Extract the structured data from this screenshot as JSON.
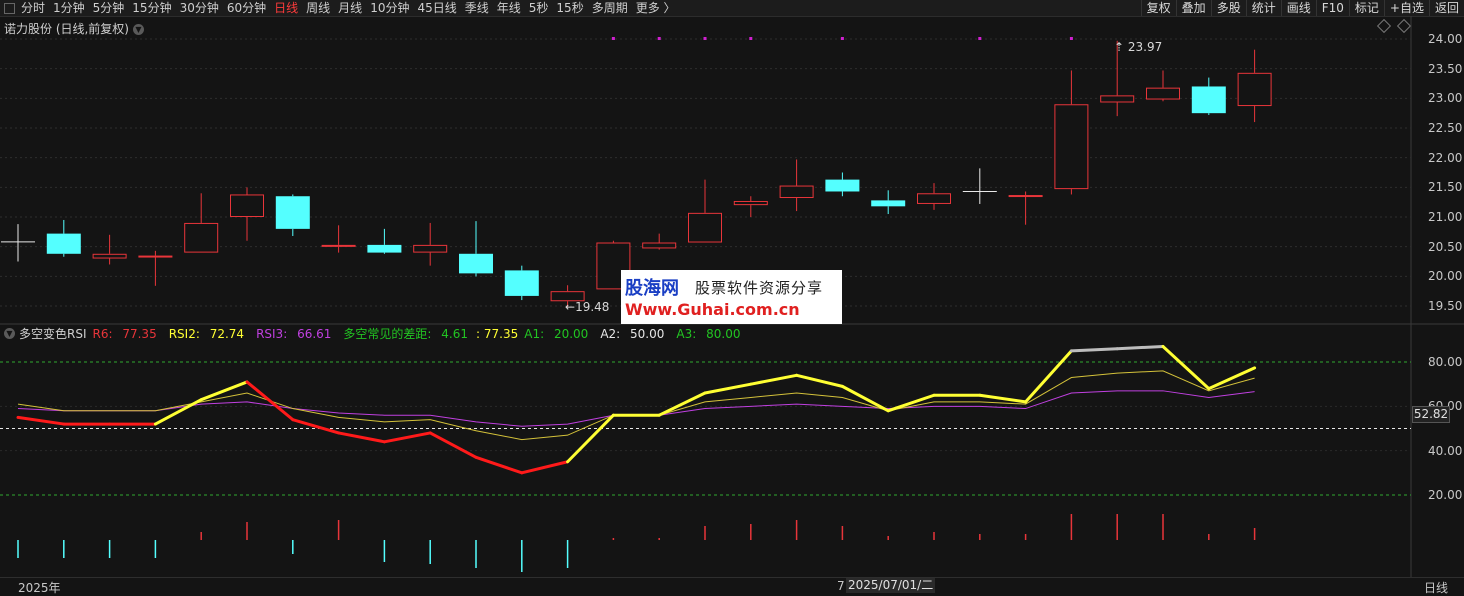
{
  "toolbar": {
    "periods": [
      "分时",
      "1分钟",
      "5分钟",
      "15分钟",
      "30分钟",
      "60分钟",
      "日线",
      "周线",
      "月线",
      "10分钟",
      "45日线",
      "季线",
      "年线",
      "5秒",
      "15秒",
      "多周期",
      "更多 〉"
    ],
    "active_period": "日线",
    "buttons": [
      "复权",
      "叠加",
      "多股",
      "统计",
      "画线",
      "F10",
      "标记",
      "+自选",
      "返回"
    ]
  },
  "stock": {
    "title": "诺力股份 (日线,前复权)"
  },
  "price_axis": {
    "ticks": [
      "24.00",
      "23.50",
      "23.00",
      "22.50",
      "22.00",
      "21.50",
      "21.00",
      "20.50",
      "20.00",
      "19.50"
    ]
  },
  "annotations": {
    "high": "23.97",
    "low": "19.48"
  },
  "indicator": {
    "name": "多空变色RSI",
    "r6_label": "R6:",
    "r6": "77.35",
    "rsi2_label": "RSI2:",
    "rsi2": "72.74",
    "rsi3_label": "RSI3:",
    "rsi3": "66.61",
    "gap_label": "多空常见的差距:",
    "gap": "4.61",
    "gap2": ": 77.35",
    "a1_label": "A1:",
    "a1": "20.00",
    "a2_label": "A2:",
    "a2": "50.00",
    "a3_label": "A3:",
    "a3": "80.00",
    "current_value": "52.82",
    "axis_ticks": [
      "80.00",
      "60.00",
      "40.00",
      "20.00"
    ]
  },
  "bottom": {
    "year": "2025年",
    "cursor_prefix": "7",
    "cursor_date": "2025/07/01/二",
    "period": "日线"
  },
  "watermark": {
    "cn_brand": "股海网",
    "cn_slogan": "股票软件资源分享",
    "url": "Www.Guhai.com.cn"
  },
  "colors": {
    "up": "#e8353a",
    "down": "#54ffff",
    "rsi_up": "#ffff33",
    "rsi_down": "#ff1a1a",
    "rsi2": "#d4c23a",
    "rsi3": "#c040e0"
  },
  "chart_data": {
    "type": "candlestick",
    "ylim": [
      19.3,
      24.15
    ],
    "candles": [
      {
        "o": 20.58,
        "c": 20.58,
        "h": 20.88,
        "l": 20.25
      },
      {
        "o": 20.72,
        "c": 20.38,
        "h": 20.95,
        "l": 20.33
      },
      {
        "o": 20.3,
        "c": 20.38,
        "h": 20.7,
        "l": 20.2
      },
      {
        "o": 20.33,
        "c": 20.35,
        "h": 20.43,
        "l": 19.84
      },
      {
        "o": 20.4,
        "c": 20.9,
        "h": 21.4,
        "l": 20.4
      },
      {
        "o": 21.0,
        "c": 21.38,
        "h": 21.5,
        "l": 20.6
      },
      {
        "o": 21.35,
        "c": 20.8,
        "h": 21.38,
        "l": 20.68
      },
      {
        "o": 20.5,
        "c": 20.53,
        "h": 20.86,
        "l": 20.4
      },
      {
        "o": 20.53,
        "c": 20.4,
        "h": 20.8,
        "l": 20.38
      },
      {
        "o": 20.4,
        "c": 20.53,
        "h": 20.9,
        "l": 20.18
      },
      {
        "o": 20.38,
        "c": 20.05,
        "h": 20.93,
        "l": 20.0
      },
      {
        "o": 20.1,
        "c": 19.67,
        "h": 20.18,
        "l": 19.6
      },
      {
        "o": 19.58,
        "c": 19.75,
        "h": 19.85,
        "l": 19.48
      },
      {
        "o": 19.78,
        "c": 20.57,
        "h": 20.6,
        "l": 19.78
      },
      {
        "o": 20.47,
        "c": 20.57,
        "h": 20.72,
        "l": 20.45
      },
      {
        "o": 20.57,
        "c": 21.07,
        "h": 21.63,
        "l": 20.57
      },
      {
        "o": 21.2,
        "c": 21.27,
        "h": 21.35,
        "l": 21.0
      },
      {
        "o": 21.32,
        "c": 21.53,
        "h": 21.97,
        "l": 21.1
      },
      {
        "o": 21.63,
        "c": 21.43,
        "h": 21.75,
        "l": 21.35
      },
      {
        "o": 21.28,
        "c": 21.18,
        "h": 21.45,
        "l": 21.05
      },
      {
        "o": 21.22,
        "c": 21.4,
        "h": 21.57,
        "l": 21.12
      },
      {
        "o": 21.43,
        "c": 21.43,
        "h": 21.82,
        "l": 21.22
      },
      {
        "o": 21.35,
        "c": 21.37,
        "h": 21.43,
        "l": 20.87
      },
      {
        "o": 21.47,
        "c": 22.9,
        "h": 23.47,
        "l": 21.38
      },
      {
        "o": 22.93,
        "c": 23.05,
        "h": 23.97,
        "l": 22.7
      },
      {
        "o": 22.98,
        "c": 23.18,
        "h": 23.47,
        "l": 22.95
      },
      {
        "o": 23.2,
        "c": 22.75,
        "h": 23.35,
        "l": 22.72
      },
      {
        "o": 22.87,
        "c": 23.43,
        "h": 23.82,
        "l": 22.6
      }
    ],
    "rsi1": [
      55,
      52,
      52,
      52,
      63,
      71,
      54,
      48,
      44,
      48,
      37,
      30,
      35,
      56,
      56,
      66,
      70,
      74,
      69,
      58,
      65,
      65,
      62,
      85,
      86,
      87,
      68,
      77.35
    ],
    "rsi2": [
      61,
      58,
      58,
      58,
      62,
      66,
      59,
      55,
      53,
      54,
      49,
      45,
      47,
      56,
      56,
      62,
      64,
      66,
      64,
      58,
      62,
      62,
      61,
      73,
      75,
      76,
      67,
      72.74
    ],
    "rsi3": [
      59,
      58,
      58,
      58,
      61,
      62,
      59,
      57,
      56,
      56,
      53,
      51,
      52,
      56,
      56,
      59,
      60,
      61,
      60,
      59,
      60,
      60,
      59,
      66,
      67,
      67,
      64,
      66.61
    ],
    "marker_x_index": [
      13,
      14,
      15,
      16,
      18,
      21,
      23
    ],
    "volume_diff": [
      1,
      1,
      1,
      1,
      0,
      1,
      1,
      1,
      1,
      1,
      1,
      1,
      1,
      0,
      0,
      1,
      1,
      1,
      1,
      0,
      1,
      1,
      0,
      1,
      1,
      1,
      0,
      1
    ],
    "volume_up": [
      false,
      false,
      false,
      false,
      true,
      true,
      false,
      true,
      false,
      false,
      false,
      false,
      false,
      true,
      true,
      true,
      true,
      true,
      true,
      true,
      true,
      true,
      true,
      true,
      true,
      true,
      true,
      true
    ]
  }
}
